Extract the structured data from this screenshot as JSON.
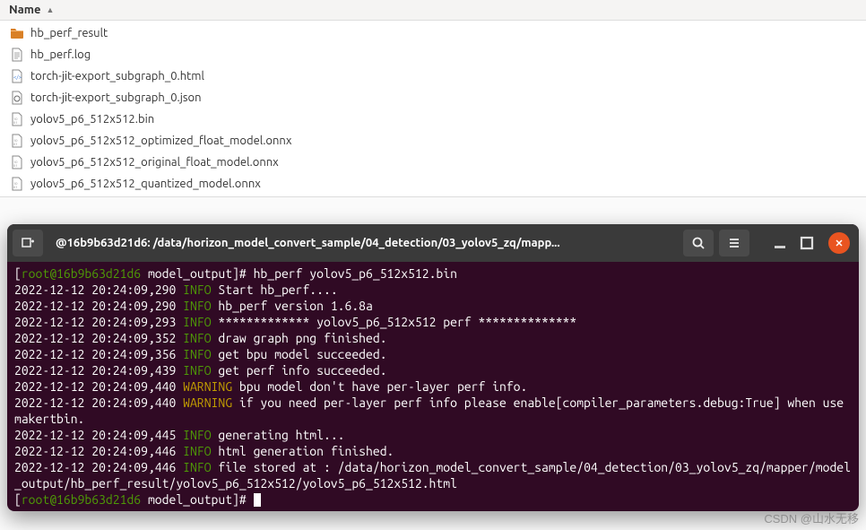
{
  "file_browser": {
    "header": "Name",
    "sort_indicator": "▲",
    "items": [
      {
        "name": "hb_perf_result",
        "icon": "folder"
      },
      {
        "name": "hb_perf.log",
        "icon": "text"
      },
      {
        "name": "torch-jit-export_subgraph_0.html",
        "icon": "html"
      },
      {
        "name": "torch-jit-export_subgraph_0.json",
        "icon": "json"
      },
      {
        "name": "yolov5_p6_512x512.bin",
        "icon": "binary"
      },
      {
        "name": "yolov5_p6_512x512_optimized_float_model.onnx",
        "icon": "binary"
      },
      {
        "name": "yolov5_p6_512x512_original_float_model.onnx",
        "icon": "binary"
      },
      {
        "name": "yolov5_p6_512x512_quantized_model.onnx",
        "icon": "binary"
      }
    ]
  },
  "terminal": {
    "title": "@16b9b63d21d6: /data/horizon_model_convert_sample/04_detection/03_yolov5_zq/mapp...",
    "prompt_user": "root@16b9b63d21d6",
    "prompt_path": "model_output",
    "command": "hb_perf yolov5_p6_512x512.bin",
    "lines": [
      {
        "ts": "2022-12-12 20:24:09,290",
        "level": "INFO",
        "msg": "Start hb_perf...."
      },
      {
        "ts": "2022-12-12 20:24:09,290",
        "level": "INFO",
        "msg": "hb_perf version 1.6.8a"
      },
      {
        "ts": "2022-12-12 20:24:09,293",
        "level": "INFO",
        "msg": "************* yolov5_p6_512x512 perf **************"
      },
      {
        "ts": "2022-12-12 20:24:09,352",
        "level": "INFO",
        "msg": "draw graph png finished."
      },
      {
        "ts": "2022-12-12 20:24:09,356",
        "level": "INFO",
        "msg": "get bpu model succeeded."
      },
      {
        "ts": "2022-12-12 20:24:09,439",
        "level": "INFO",
        "msg": "get perf info succeeded."
      },
      {
        "ts": "2022-12-12 20:24:09,440",
        "level": "WARNING",
        "msg": "bpu model don't have per-layer perf info."
      },
      {
        "ts": "2022-12-12 20:24:09,440",
        "level": "WARNING",
        "msg": "if you need per-layer perf info please enable[compiler_parameters.debug:True] when use makertbin."
      },
      {
        "ts": "2022-12-12 20:24:09,445",
        "level": "INFO",
        "msg": "generating html..."
      },
      {
        "ts": "2022-12-12 20:24:09,446",
        "level": "INFO",
        "msg": "html generation finished."
      },
      {
        "ts": "2022-12-12 20:24:09,446",
        "level": "INFO",
        "msg": "file stored at : /data/horizon_model_convert_sample/04_detection/03_yolov5_zq/mapper/model_output/hb_perf_result/yolov5_p6_512x512/yolov5_p6_512x512.html"
      }
    ]
  },
  "watermark": "CSDN @山水无移"
}
